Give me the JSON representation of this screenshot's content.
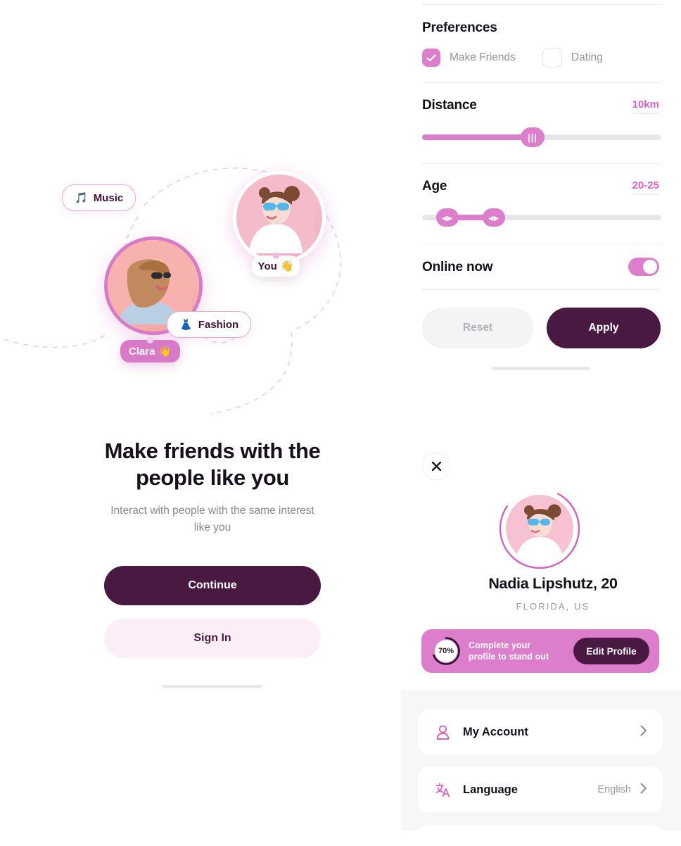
{
  "onboarding": {
    "illustration": {
      "avatars": [
        {
          "id": "you",
          "badge_label": "You",
          "badge_emoji": "👋"
        },
        {
          "id": "clara",
          "badge_label": "Clara",
          "badge_emoji": "👋"
        }
      ],
      "interest_chips": [
        {
          "emoji": "🎵",
          "label": "Music"
        },
        {
          "emoji": "👗",
          "label": "Fashion"
        }
      ]
    },
    "headline": "Make friends with the people like you",
    "subtitle": "Interact with people with the same interest like you",
    "primary_button": "Continue",
    "secondary_button": "Sign In"
  },
  "filters": {
    "preferences": {
      "title": "Preferences",
      "options": [
        {
          "label": "Make Friends",
          "checked": true
        },
        {
          "label": "Dating",
          "checked": false
        }
      ]
    },
    "distance": {
      "title": "Distance",
      "value": "10km",
      "fill_percent": 44
    },
    "age": {
      "title": "Age",
      "value": "20-25",
      "min_percent": 9,
      "max_percent": 29
    },
    "online": {
      "title": "Online now",
      "enabled": true
    },
    "reset_button": "Reset",
    "apply_button": "Apply"
  },
  "profile": {
    "close_label": "×",
    "name": "Nadia Lipshutz, 20",
    "location": "FLORIDA, US",
    "completion": {
      "percent_label": "70%",
      "percent_value": 70,
      "message_line1": "Complete your",
      "message_line2": "profile to stand out",
      "button": "Edit Profile"
    },
    "menu": [
      {
        "icon": "person-icon",
        "label": "My Account",
        "value": ""
      },
      {
        "icon": "translate-icon",
        "label": "Language",
        "value": "English"
      }
    ]
  },
  "colors": {
    "accent_pink": "#dd7ecd",
    "deep_purple": "#4a1942",
    "value_pink": "#e05fc6",
    "panel_gray": "#f7f7fa"
  }
}
